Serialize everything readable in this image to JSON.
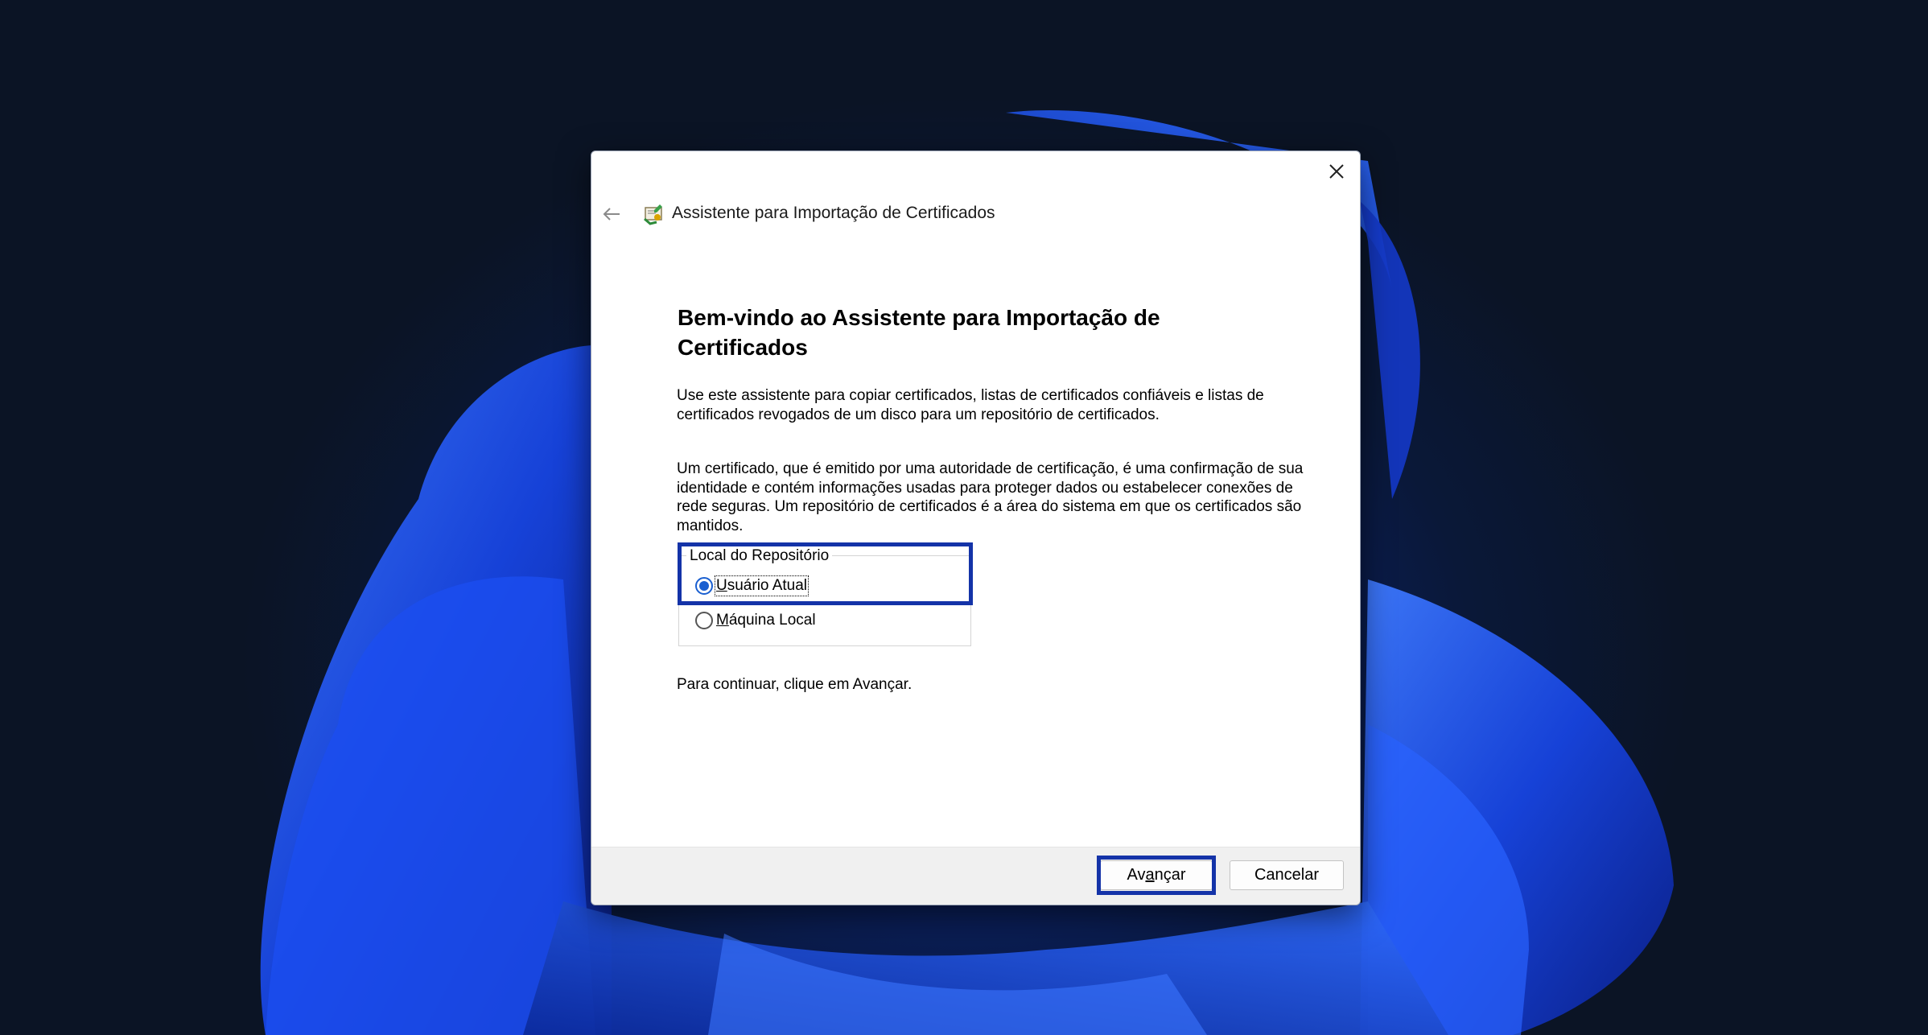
{
  "window": {
    "title": "Assistente para Importação de Certificados"
  },
  "content": {
    "heading": "Bem-vindo ao Assistente para Importação de Certificados",
    "paragraph1": "Use este assistente para copiar certificados, listas de certificados confiáveis e listas de certificados revogados de um disco para um repositório de certificados.",
    "paragraph2": "Um certificado, que é emitido por uma autoridade de certificação, é uma confirmação de sua identidade e contém informações usadas para proteger dados ou estabelecer conexões de rede seguras. Um repositório de certificados é a área do sistema em que os certificados são mantidos.",
    "store_group": {
      "legend": "Local do Repositório",
      "options": [
        {
          "label": "Usuário Atual",
          "checked": true
        },
        {
          "label": "Máquina Local",
          "checked": false
        }
      ]
    },
    "continue_hint": "Para continuar, clique em Avançar."
  },
  "footer": {
    "next_label_prefix": "Av",
    "next_label_ul": "a",
    "next_label_suffix": "nçar",
    "cancel_label": "Cancelar"
  },
  "icons": {
    "back": "arrow-left-icon",
    "close": "close-icon",
    "wizard": "certificate-icon"
  },
  "colors": {
    "highlight": "#1433a8",
    "radio_accent": "#1a5fd0",
    "footer_bg": "#f0f0f0"
  }
}
